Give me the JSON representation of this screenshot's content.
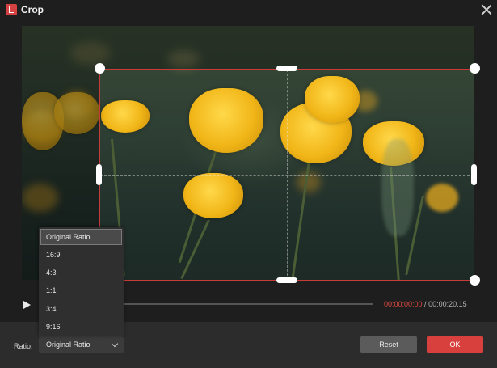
{
  "window": {
    "title": "Crop"
  },
  "icons": {
    "app": "app-logo-icon",
    "close": "close-icon",
    "play": "play-icon",
    "chevron": "chevron-down-icon"
  },
  "player": {
    "current_time": "00:00:00:00",
    "separator": " / ",
    "total_time": "00:00:20.15"
  },
  "ratio": {
    "label": "Ratio:",
    "selected": "Original Ratio",
    "options": [
      "Original Ratio",
      "16:9",
      "4:3",
      "1:1",
      "3:4",
      "9:16"
    ]
  },
  "buttons": {
    "reset": "Reset",
    "ok": "OK"
  },
  "colors": {
    "accent": "#d8403d",
    "crop_border": "#c73b3b",
    "background": "#1e1e1e",
    "footer": "#2c2c2c"
  }
}
